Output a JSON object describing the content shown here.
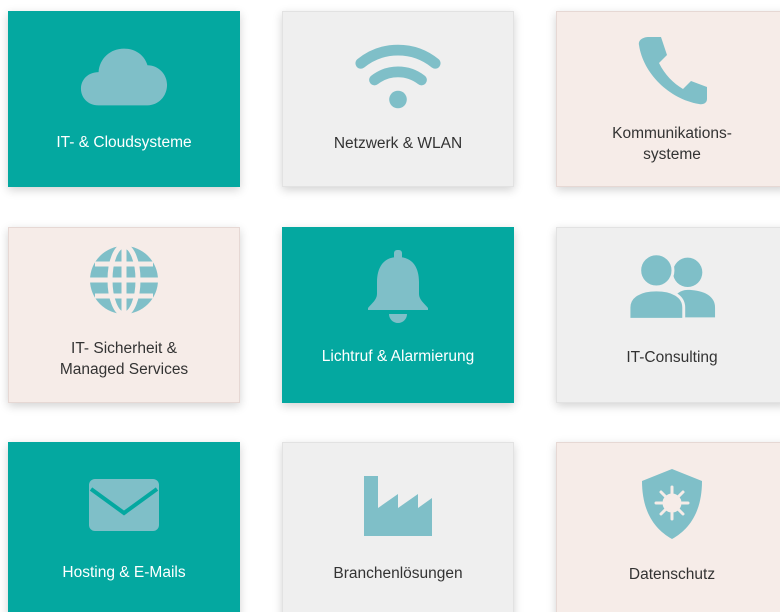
{
  "colors": {
    "teal": "#04a8a0",
    "grey": "#efefef",
    "pink": "#f6ece8",
    "icon": "#7fbfc8"
  },
  "tiles": [
    {
      "label": "IT- & Cloudsysteme",
      "icon": "cloud-icon",
      "style": "teal"
    },
    {
      "label": "Netzwerk & WLAN",
      "icon": "wifi-icon",
      "style": "grey"
    },
    {
      "label": "Kommunikations-\nsysteme",
      "icon": "phone-icon",
      "style": "pink"
    },
    {
      "label": "IT- Sicherheit &\nManaged Services",
      "icon": "globe-icon",
      "style": "pink"
    },
    {
      "label": "Lichtruf & Alarmierung",
      "icon": "bell-icon",
      "style": "teal"
    },
    {
      "label": "IT-Consulting",
      "icon": "users-icon",
      "style": "grey"
    },
    {
      "label": "Hosting & E-Mails",
      "icon": "envelope-icon",
      "style": "teal"
    },
    {
      "label": "Branchenlösungen",
      "icon": "factory-icon",
      "style": "grey"
    },
    {
      "label": "Datenschutz",
      "icon": "shield-virus-icon",
      "style": "pink"
    }
  ]
}
